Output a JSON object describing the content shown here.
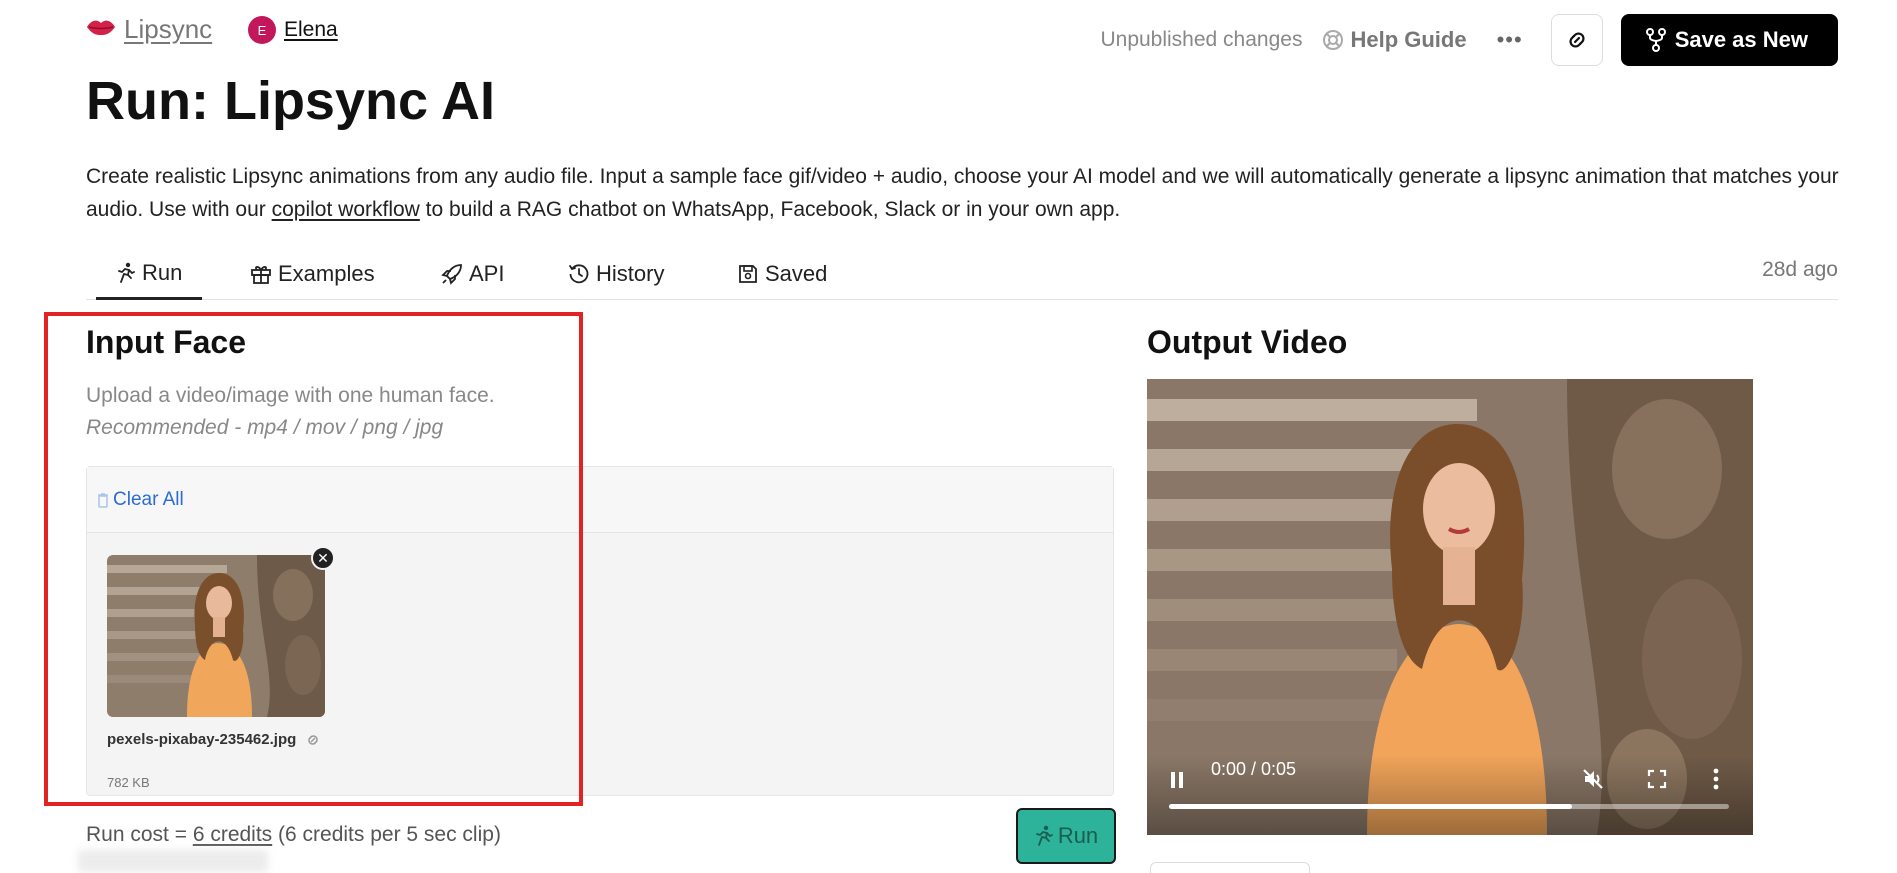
{
  "header": {
    "brand": "Lipsync",
    "user_initial": "E",
    "user_name": "Elena",
    "status": "Unpublished changes",
    "help_label": "Help Guide",
    "more_label": "•••",
    "save_label": "Save as New"
  },
  "page": {
    "title": "Run: Lipsync AI",
    "desc_part1": "Create realistic Lipsync animations from any audio file. Input a sample face gif/video + audio, choose your AI model and we will automatically generate a lipsync animation that matches your audio. Use with our ",
    "desc_link": "copilot workflow",
    "desc_part2": " to build a RAG chatbot on WhatsApp, Facebook, Slack or in your own app."
  },
  "tabs": [
    {
      "label": "Run",
      "icon": "run-icon",
      "active": true
    },
    {
      "label": "Examples",
      "icon": "gift-icon"
    },
    {
      "label": "API",
      "icon": "rocket-icon"
    },
    {
      "label": "History",
      "icon": "history-icon"
    },
    {
      "label": "Saved",
      "icon": "save-icon"
    }
  ],
  "last_updated": "28d ago",
  "input_face": {
    "title": "Input Face",
    "hint": "Upload a video/image with one human face.",
    "recommended": "Recommended - mp4 / mov / png / jpg",
    "clear_all": "Clear All",
    "file_name": "pexels-pixabay-235462.jpg",
    "file_size": "782 KB"
  },
  "run_cost": {
    "prefix": "Run cost = ",
    "credits": "6 credits",
    "suffix": " (6 credits per 5 sec clip)"
  },
  "run_button": "Run",
  "output": {
    "title": "Output Video",
    "time": "0:00 / 0:05",
    "progress": 0.72
  },
  "colors": {
    "accent_teal": "#2cb39a",
    "highlight_red": "#e02424",
    "link_blue": "#2b6cd4"
  }
}
